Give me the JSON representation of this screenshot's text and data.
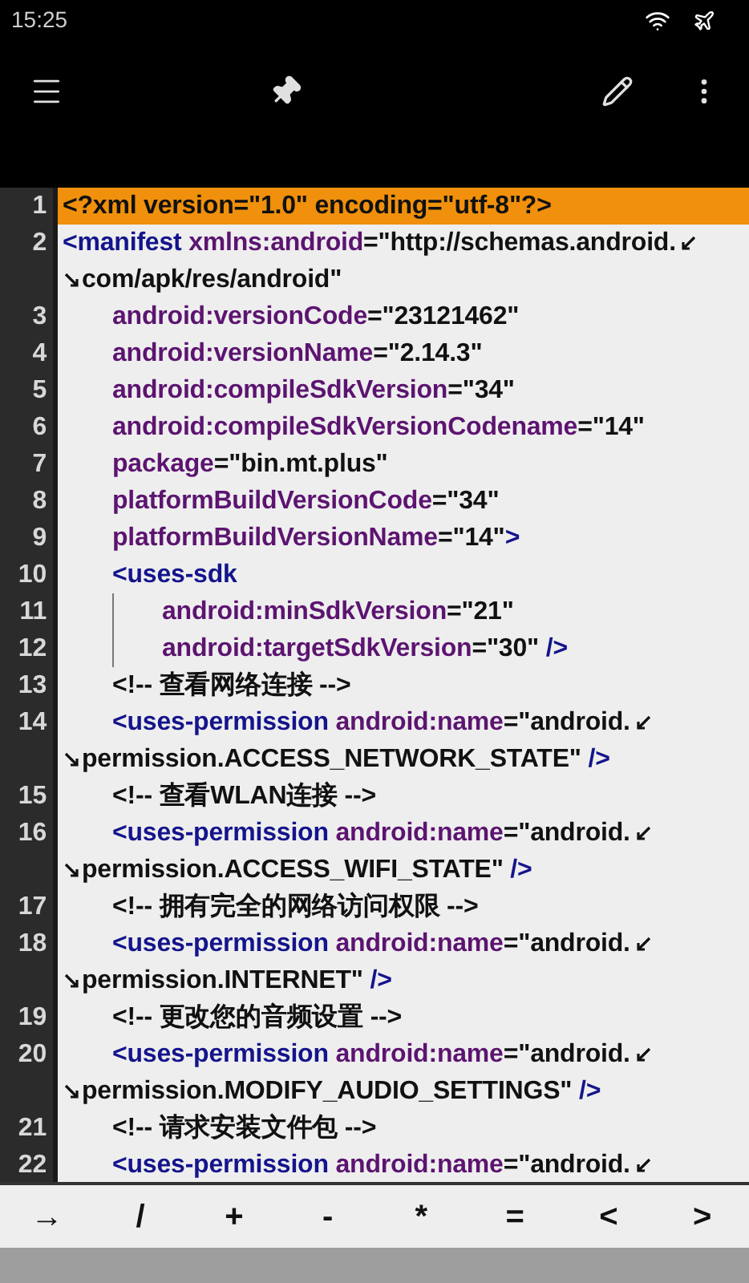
{
  "status_bar": {
    "time": "15:25"
  },
  "editor": {
    "lines": [
      {
        "number": "1",
        "selected": true,
        "segments": [
          {
            "kind": "punct",
            "text": "<?xml version=\"1.0\" encoding=\"utf-8\"?>"
          }
        ]
      },
      {
        "number": "2",
        "selected": false,
        "segments": [
          {
            "kind": "tag",
            "text": "<manifest"
          },
          {
            "kind": "attr",
            "text": " xmlns:android"
          },
          {
            "kind": "value",
            "text": "=\"http://schemas.android."
          }
        ],
        "continuation": [
          {
            "kind": "value",
            "text": "com/apk/res/android\""
          }
        ],
        "children": [
          {
            "number": "3",
            "selected": false,
            "segments": [
              {
                "kind": "attr",
                "text": "android:versionCode"
              },
              {
                "kind": "value",
                "text": "=\"23121462\""
              }
            ]
          },
          {
            "number": "4",
            "selected": false,
            "segments": [
              {
                "kind": "attr",
                "text": "android:versionName"
              },
              {
                "kind": "value",
                "text": "=\"2.14.3\""
              }
            ]
          },
          {
            "number": "5",
            "selected": false,
            "segments": [
              {
                "kind": "attr",
                "text": "android:compileSdkVersion"
              },
              {
                "kind": "value",
                "text": "=\"34\""
              }
            ]
          },
          {
            "number": "6",
            "selected": false,
            "segments": [
              {
                "kind": "attr",
                "text": "android:compileSdkVersionCodename"
              },
              {
                "kind": "value",
                "text": "=\"14\""
              }
            ]
          },
          {
            "number": "7",
            "selected": false,
            "segments": [
              {
                "kind": "attr",
                "text": "package"
              },
              {
                "kind": "value",
                "text": "=\"bin.mt.plus\""
              }
            ]
          },
          {
            "number": "8",
            "selected": false,
            "segments": [
              {
                "kind": "attr",
                "text": "platformBuildVersionCode"
              },
              {
                "kind": "value",
                "text": "=\"34\""
              }
            ]
          },
          {
            "number": "9",
            "selected": false,
            "segments": [
              {
                "kind": "attr",
                "text": "platformBuildVersionName"
              },
              {
                "kind": "value",
                "text": "=\"14\""
              },
              {
                "kind": "tag",
                "text": ">"
              }
            ]
          },
          {
            "number": "10",
            "selected": false,
            "segments": [
              {
                "kind": "tag",
                "text": "<uses-sdk"
              }
            ],
            "children": [
              {
                "number": "11",
                "selected": false,
                "segments": [
                  {
                    "kind": "attr",
                    "text": "android:minSdkVersion"
                  },
                  {
                    "kind": "value",
                    "text": "=\"21\""
                  }
                ]
              },
              {
                "number": "12",
                "selected": false,
                "segments": [
                  {
                    "kind": "attr",
                    "text": "android:targetSdkVersion"
                  },
                  {
                    "kind": "value",
                    "text": "=\"30\""
                  },
                  {
                    "kind": "tag",
                    "text": " />"
                  }
                ]
              }
            ]
          },
          {
            "number": "13",
            "selected": false,
            "segments": [
              {
                "kind": "comment",
                "text": "<!-- 查看网络连接 -->"
              }
            ]
          },
          {
            "number": "14",
            "selected": false,
            "segments": [
              {
                "kind": "tag",
                "text": "<uses-permission"
              },
              {
                "kind": "attr",
                "text": " android:name"
              },
              {
                "kind": "value",
                "text": "=\"android."
              }
            ],
            "continuation": [
              {
                "kind": "value",
                "text": "permission.ACCESS_NETWORK_STATE\""
              },
              {
                "kind": "tag",
                "text": " />"
              }
            ]
          },
          {
            "number": "15",
            "selected": false,
            "segments": [
              {
                "kind": "comment",
                "text": "<!-- 查看WLAN连接 -->"
              }
            ]
          },
          {
            "number": "16",
            "selected": false,
            "segments": [
              {
                "kind": "tag",
                "text": "<uses-permission"
              },
              {
                "kind": "attr",
                "text": " android:name"
              },
              {
                "kind": "value",
                "text": "=\"android."
              }
            ],
            "continuation": [
              {
                "kind": "value",
                "text": "permission.ACCESS_WIFI_STATE\""
              },
              {
                "kind": "tag",
                "text": " />"
              }
            ]
          },
          {
            "number": "17",
            "selected": false,
            "segments": [
              {
                "kind": "comment",
                "text": "<!-- 拥有完全的网络访问权限 -->"
              }
            ]
          },
          {
            "number": "18",
            "selected": false,
            "segments": [
              {
                "kind": "tag",
                "text": "<uses-permission"
              },
              {
                "kind": "attr",
                "text": " android:name"
              },
              {
                "kind": "value",
                "text": "=\"android."
              }
            ],
            "continuation": [
              {
                "kind": "value",
                "text": "permission.INTERNET\""
              },
              {
                "kind": "tag",
                "text": " />"
              }
            ]
          },
          {
            "number": "19",
            "selected": false,
            "segments": [
              {
                "kind": "comment",
                "text": "<!-- 更改您的音频设置 -->"
              }
            ]
          },
          {
            "number": "20",
            "selected": false,
            "segments": [
              {
                "kind": "tag",
                "text": "<uses-permission"
              },
              {
                "kind": "attr",
                "text": " android:name"
              },
              {
                "kind": "value",
                "text": "=\"android."
              }
            ],
            "continuation": [
              {
                "kind": "value",
                "text": "permission.MODIFY_AUDIO_SETTINGS\""
              },
              {
                "kind": "tag",
                "text": " />"
              }
            ]
          },
          {
            "number": "21",
            "selected": false,
            "segments": [
              {
                "kind": "comment",
                "text": "<!-- 请求安装文件包 -->"
              }
            ]
          },
          {
            "number": "22",
            "selected": false,
            "segments": [
              {
                "kind": "tag",
                "text": "<uses-permission"
              },
              {
                "kind": "attr",
                "text": " android:name"
              },
              {
                "kind": "value",
                "text": "=\"android."
              }
            ],
            "wrapped": true
          }
        ]
      }
    ]
  },
  "symbol_bar": {
    "keys": [
      "→",
      "/",
      "+",
      "-",
      "*",
      "=",
      "<",
      ">"
    ]
  }
}
